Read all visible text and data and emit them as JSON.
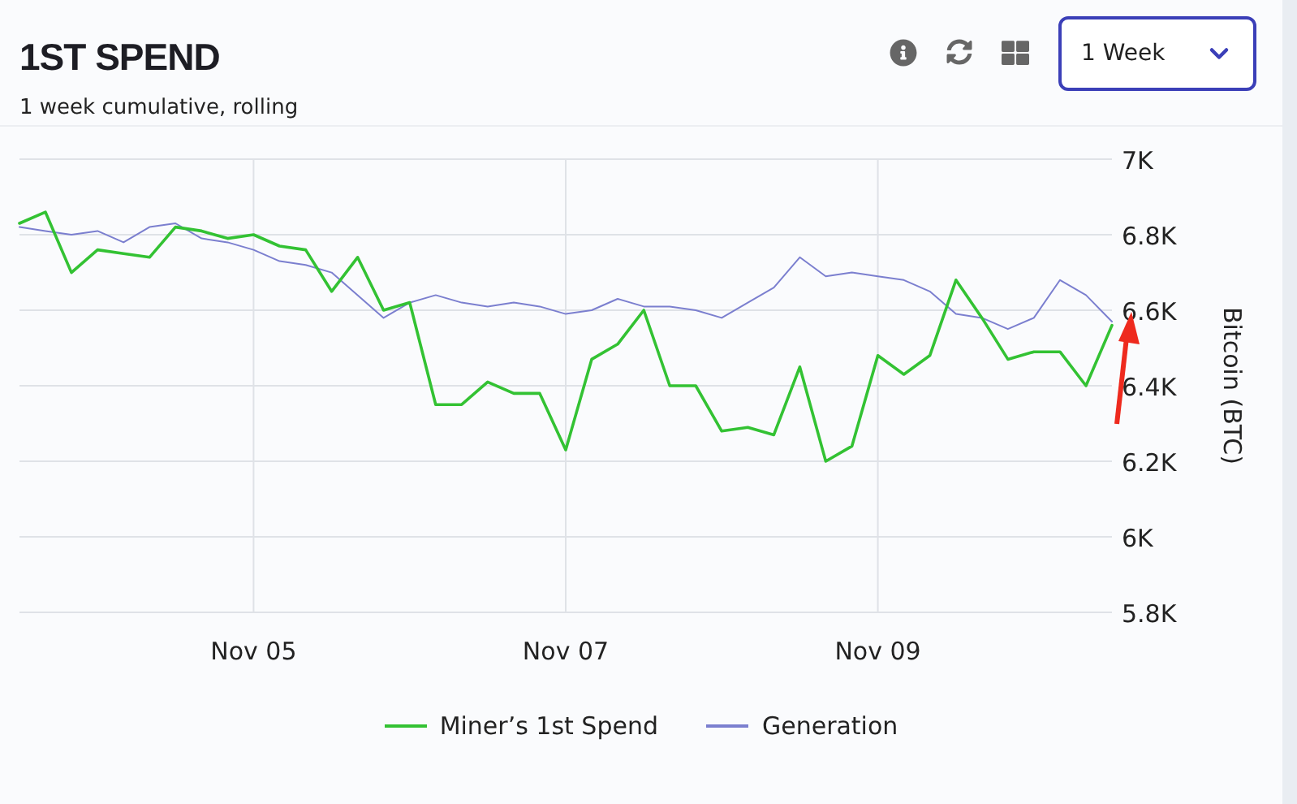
{
  "header": {
    "title": "1ST SPEND",
    "subtitle": "1 week cumulative, rolling",
    "range_select": {
      "value": "1 Week"
    }
  },
  "chart_data": {
    "type": "line",
    "grid": true,
    "legend": "bottom",
    "ylabel": "Bitcoin (BTC)",
    "categories": [
      null,
      null,
      null,
      null,
      null,
      null,
      null,
      null,
      null,
      "Nov 05",
      null,
      null,
      null,
      null,
      null,
      null,
      null,
      null,
      null,
      null,
      null,
      "Nov 07",
      null,
      null,
      null,
      null,
      null,
      null,
      null,
      null,
      null,
      null,
      null,
      "Nov 09",
      null,
      null,
      null,
      null,
      null,
      null,
      null,
      null,
      null
    ],
    "ylim": [
      5800,
      7000
    ],
    "yticks": [
      {
        "value": 5800,
        "label": "5.8K"
      },
      {
        "value": 6000,
        "label": "6K"
      },
      {
        "value": 6200,
        "label": "6.2K"
      },
      {
        "value": 6400,
        "label": "6.4K"
      },
      {
        "value": 6600,
        "label": "6.6K"
      },
      {
        "value": 6800,
        "label": "6.8K"
      },
      {
        "value": 7000,
        "label": "7K"
      }
    ],
    "series": [
      {
        "name": "Miner’s 1st Spend",
        "color": "#33c233",
        "values": [
          6830,
          6860,
          6700,
          6760,
          6750,
          6740,
          6820,
          6810,
          6790,
          6800,
          6770,
          6760,
          6650,
          6740,
          6600,
          6620,
          6350,
          6350,
          6410,
          6380,
          6380,
          6230,
          6470,
          6510,
          6600,
          6400,
          6400,
          6280,
          6290,
          6270,
          6450,
          6200,
          6240,
          6480,
          6430,
          6480,
          6680,
          6580,
          6470,
          6490,
          6490,
          6400,
          6560
        ]
      },
      {
        "name": "Generation",
        "color": "#7b7fcf",
        "values": [
          6820,
          6810,
          6800,
          6810,
          6780,
          6820,
          6830,
          6790,
          6780,
          6760,
          6730,
          6720,
          6700,
          6640,
          6580,
          6620,
          6640,
          6620,
          6610,
          6620,
          6610,
          6590,
          6600,
          6630,
          6610,
          6610,
          6600,
          6580,
          6620,
          6660,
          6740,
          6690,
          6700,
          6690,
          6680,
          6650,
          6590,
          6580,
          6550,
          6580,
          6680,
          6640,
          6570
        ]
      }
    ]
  }
}
